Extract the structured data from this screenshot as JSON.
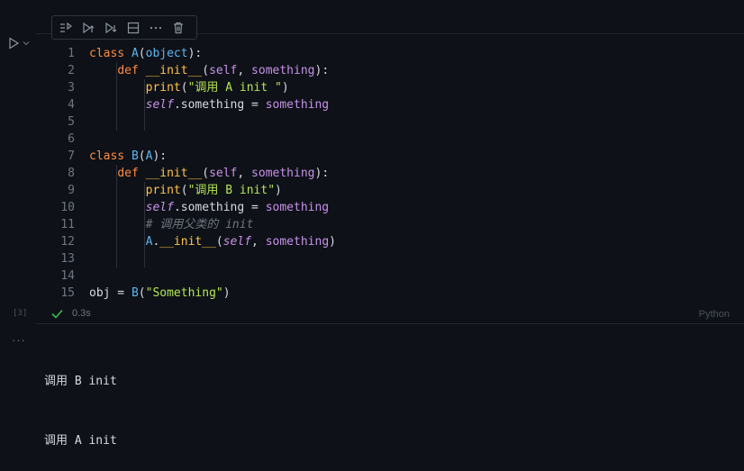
{
  "toolbar": {
    "icons": [
      "run-by-line-icon",
      "execute-above-icon",
      "execute-below-icon",
      "split-cell-icon",
      "more-icon",
      "delete-icon"
    ]
  },
  "cell": {
    "exec_count": "[3]",
    "status_time": "0.3s",
    "language": "Python"
  },
  "code_lines": [
    {
      "num": "1",
      "tokens": [
        [
          "kw",
          "class"
        ],
        [
          "pl",
          " "
        ],
        [
          "cls",
          "A"
        ],
        [
          "pn",
          "("
        ],
        [
          "cls",
          "object"
        ],
        [
          "pn",
          "):"
        ]
      ]
    },
    {
      "num": "2",
      "tokens": [
        [
          "pl",
          "    "
        ],
        [
          "kw",
          "def"
        ],
        [
          "pl",
          " "
        ],
        [
          "fn",
          "__init__"
        ],
        [
          "pn",
          "("
        ],
        [
          "par",
          "self"
        ],
        [
          "pn",
          ", "
        ],
        [
          "par",
          "something"
        ],
        [
          "pn",
          "):"
        ]
      ]
    },
    {
      "num": "3",
      "tokens": [
        [
          "pl",
          "        "
        ],
        [
          "fn",
          "print"
        ],
        [
          "pn",
          "("
        ],
        [
          "str",
          "\"调用 A init \""
        ],
        [
          "pn",
          ")"
        ]
      ]
    },
    {
      "num": "4",
      "tokens": [
        [
          "pl",
          "        "
        ],
        [
          "self",
          "self"
        ],
        [
          "pl",
          ".something = "
        ],
        [
          "par",
          "something"
        ]
      ]
    },
    {
      "num": "5",
      "tokens": []
    },
    {
      "num": "6",
      "tokens": []
    },
    {
      "num": "7",
      "tokens": [
        [
          "kw",
          "class"
        ],
        [
          "pl",
          " "
        ],
        [
          "cls",
          "B"
        ],
        [
          "pn",
          "("
        ],
        [
          "cls",
          "A"
        ],
        [
          "pn",
          "):"
        ]
      ]
    },
    {
      "num": "8",
      "tokens": [
        [
          "pl",
          "    "
        ],
        [
          "kw",
          "def"
        ],
        [
          "pl",
          " "
        ],
        [
          "fn",
          "__init__"
        ],
        [
          "pn",
          "("
        ],
        [
          "par",
          "self"
        ],
        [
          "pn",
          ", "
        ],
        [
          "par",
          "something"
        ],
        [
          "pn",
          "):"
        ]
      ]
    },
    {
      "num": "9",
      "tokens": [
        [
          "pl",
          "        "
        ],
        [
          "fn",
          "print"
        ],
        [
          "pn",
          "("
        ],
        [
          "str",
          "\"调用 B init\""
        ],
        [
          "pn",
          ")"
        ]
      ]
    },
    {
      "num": "10",
      "tokens": [
        [
          "pl",
          "        "
        ],
        [
          "self",
          "self"
        ],
        [
          "pl",
          ".something = "
        ],
        [
          "par",
          "something"
        ]
      ]
    },
    {
      "num": "11",
      "tokens": [
        [
          "pl",
          "        "
        ],
        [
          "cm",
          "# 调用父类的 init"
        ]
      ]
    },
    {
      "num": "12",
      "tokens": [
        [
          "pl",
          "        "
        ],
        [
          "cls",
          "A"
        ],
        [
          "pl",
          "."
        ],
        [
          "fn",
          "__init__"
        ],
        [
          "pn",
          "("
        ],
        [
          "self",
          "self"
        ],
        [
          "pn",
          ", "
        ],
        [
          "par",
          "something"
        ],
        [
          "pn",
          ")"
        ]
      ]
    },
    {
      "num": "13",
      "tokens": []
    },
    {
      "num": "14",
      "tokens": []
    },
    {
      "num": "15",
      "tokens": [
        [
          "pl",
          "obj = "
        ],
        [
          "cls",
          "B"
        ],
        [
          "pn",
          "("
        ],
        [
          "str",
          "\"Something\""
        ],
        [
          "pn",
          ")"
        ]
      ]
    }
  ],
  "output": {
    "dots": "···",
    "lines": [
      "调用 B init",
      "调用 A init"
    ]
  },
  "colors": {
    "background": "#0e1117",
    "success": "#3fb950"
  }
}
